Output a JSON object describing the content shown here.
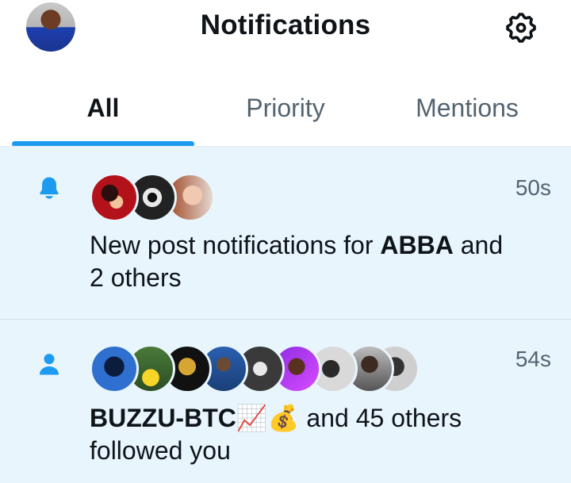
{
  "header": {
    "title": "Notifications",
    "avatar_icon": "profile-avatar",
    "settings_icon": "gear-icon"
  },
  "tabs": [
    {
      "label": "All",
      "active": true
    },
    {
      "label": "Priority",
      "active": false
    },
    {
      "label": "Mentions",
      "active": false
    }
  ],
  "notifications": [
    {
      "icon": "bell-icon",
      "time": "50s",
      "text_prefix": "New post notifications for ",
      "bold_name": "ABBA",
      "text_suffix": " and",
      "text_line2": "2 others",
      "avatar_count": 3
    },
    {
      "icon": "person-icon",
      "time": "54s",
      "bold_name": "BUZZU-BTC📈💰",
      "text_suffix": " and 45 others",
      "text_line2": "followed you",
      "avatar_count": 9
    }
  ],
  "colors": {
    "accent": "#1d9bf0",
    "unread_background": "#e8f5fd",
    "secondary_text": "#536471"
  }
}
